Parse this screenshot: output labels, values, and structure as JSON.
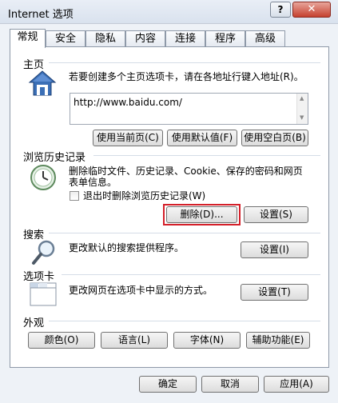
{
  "window": {
    "title": "Internet 选项",
    "help_label": "?",
    "close_label": "✕"
  },
  "tabs": [
    "常规",
    "安全",
    "隐私",
    "内容",
    "连接",
    "程序",
    "高级"
  ],
  "home": {
    "title": "主页",
    "description": "若要创建多个主页选项卡，请在各地址行键入地址(R)。",
    "url": "http://www.baidu.com/",
    "buttons": [
      "使用当前页(C)",
      "使用默认值(F)",
      "使用空白页(B)"
    ]
  },
  "history": {
    "title": "浏览历史记录",
    "description_line1": "删除临时文件、历史记录、Cookie、保存的密码和网页",
    "description_line2": "表单信息。",
    "checkbox_label": "退出时删除浏览历史记录(W)",
    "checked": false,
    "delete_button": "删除(D)...",
    "settings_button": "设置(S)"
  },
  "search": {
    "title": "搜索",
    "description": "更改默认的搜索提供程序。",
    "settings_button": "设置(I)"
  },
  "tabbed": {
    "title": "选项卡",
    "description": "更改网页在选项卡中显示的方式。",
    "settings_button": "设置(T)"
  },
  "appearance": {
    "title": "外观",
    "buttons": [
      "颜色(O)",
      "语言(L)",
      "字体(N)",
      "辅助功能(E)"
    ]
  },
  "footer": {
    "ok": "确定",
    "cancel": "取消",
    "apply": "应用(A)"
  },
  "colors": {
    "highlight_box": "#d4202a",
    "title_gradient_top": "#e9eef6"
  }
}
